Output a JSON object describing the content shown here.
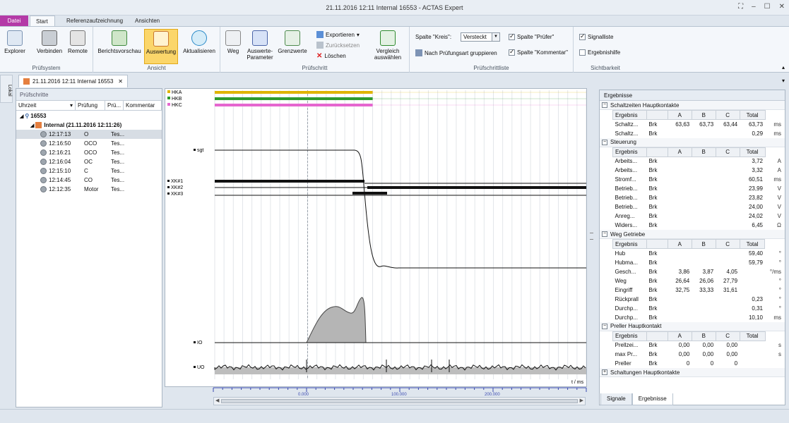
{
  "window": {
    "title": "21.11.2016 12:11 Internal 16553 - ACTAS Expert"
  },
  "ribbon_tabs": [
    "Datei",
    "Start",
    "Referenzaufzeichnung",
    "Ansichten"
  ],
  "ribbon": {
    "pruefsystem": {
      "label": "Prüfsystem",
      "explorer": "Explorer",
      "verbinden": "Verbinden",
      "remote": "Remote"
    },
    "ansicht": {
      "label": "Ansicht",
      "berichtsvorschau": "Berichtsvorschau",
      "auswertung": "Auswertung",
      "aktualisieren": "Aktualisieren"
    },
    "pruefschritt": {
      "label": "Prüfschritt",
      "weg": "Weg",
      "auswerteparameter_1": "Auswerte-",
      "auswerteparameter_2": "Parameter",
      "grenzwerte": "Grenzwerte",
      "exportieren": "Exportieren",
      "zuruecksetzen": "Zurücksetzen",
      "loeschen": "Löschen",
      "vergleich_1": "Vergleich",
      "vergleich_2": "auswählen"
    },
    "pruefschrittliste": {
      "label": "Prüfschrittliste",
      "spalte_kreis": "Spalte \"Kreis\":",
      "versteckt": "Versteckt",
      "nach_pruefungsart": "Nach Prüfungsart gruppieren",
      "spalte_pruefer": "Spalte \"Prüfer\"",
      "spalte_kommentar": "Spalte \"Kommentar\""
    },
    "sichtbarkeit": {
      "label": "Sichtbarkeit",
      "signalliste": "Signalliste",
      "ergebnishilfe": "Ergebnishilfe"
    }
  },
  "side_tab": "Lokal",
  "doc_tab": "21.11.2016 12:11 Internal 16553",
  "pruefschritte": {
    "header": "Prüfschritte",
    "columns": [
      "Uhrzeit",
      "Prüfung",
      "Prü...",
      "Kommentar"
    ],
    "root": "16553",
    "session": "Internal (21.11.2016 12:11:26)",
    "rows": [
      {
        "time": "12:17:13",
        "test": "O",
        "pruefer": "Tes...",
        "selected": true
      },
      {
        "time": "12:16:50",
        "test": "OCO",
        "pruefer": "Tes..."
      },
      {
        "time": "12:16:21",
        "test": "OCO",
        "pruefer": "Tes..."
      },
      {
        "time": "12:16:04",
        "test": "OC",
        "pruefer": "Tes..."
      },
      {
        "time": "12:15:10",
        "test": "C",
        "pruefer": "Tes..."
      },
      {
        "time": "12:14:45",
        "test": "CO",
        "pruefer": "Tes..."
      },
      {
        "time": "12:12:35",
        "test": "Motor",
        "pruefer": "Tes..."
      }
    ]
  },
  "chart_data": {
    "type": "line",
    "xlabel": "t / ms",
    "x_ticks": [
      "0.000",
      "100.000",
      "200.000"
    ],
    "xlim": [
      -100,
      300
    ],
    "signals": [
      {
        "name": "HKA",
        "color": "#e0b400"
      },
      {
        "name": "HKB",
        "color": "#2e9a2e"
      },
      {
        "name": "HKC",
        "color": "#e566cf"
      },
      {
        "name": "sgt"
      },
      {
        "name": "XK#1"
      },
      {
        "name": "XK#2"
      },
      {
        "name": "XK#3"
      },
      {
        "name": "IO"
      },
      {
        "name": "UO"
      }
    ],
    "bars": {
      "HKA_end_ms": 70,
      "HKB_end_ms": 70,
      "HKC_end_ms": 70
    }
  },
  "ergebnisse": {
    "header": "Ergebnisse",
    "cols": [
      "Ergebnis",
      "",
      "A",
      "B",
      "C",
      "Total"
    ],
    "sections": [
      {
        "title": "Schaltzeiten Hauptkontakte",
        "rows": [
          [
            "Schaltz...",
            "Brk",
            "63,63",
            "63,73",
            "63,44",
            "63,73",
            "ms"
          ],
          [
            "Schaltz...",
            "Brk",
            "",
            "",
            "",
            "0,29",
            "ms"
          ]
        ]
      },
      {
        "title": "Steuerung",
        "rows": [
          [
            "Arbeits...",
            "Brk",
            "",
            "",
            "",
            "3,72",
            "A"
          ],
          [
            "Arbeits...",
            "Brk",
            "",
            "",
            "",
            "3,32",
            "A"
          ],
          [
            "Stromf...",
            "Brk",
            "",
            "",
            "",
            "60,51",
            "ms"
          ],
          [
            "Betrieb...",
            "Brk",
            "",
            "",
            "",
            "23,99",
            "V"
          ],
          [
            "Betrieb...",
            "Brk",
            "",
            "",
            "",
            "23,82",
            "V"
          ],
          [
            "Betrieb...",
            "Brk",
            "",
            "",
            "",
            "24,00",
            "V"
          ],
          [
            "Anreg...",
            "Brk",
            "",
            "",
            "",
            "24,02",
            "V"
          ],
          [
            "Widers...",
            "Brk",
            "",
            "",
            "",
            "6,45",
            "Ω"
          ]
        ]
      },
      {
        "title": "Weg Getriebe",
        "rows": [
          [
            "Hub",
            "Brk",
            "",
            "",
            "",
            "59,40",
            "°"
          ],
          [
            "Hubma...",
            "Brk",
            "",
            "",
            "",
            "59,79",
            "°"
          ],
          [
            "Gesch...",
            "Brk",
            "3,86",
            "3,87",
            "4,05",
            "",
            "°/ms"
          ],
          [
            "Weg",
            "Brk",
            "26,64",
            "26,06",
            "27,79",
            "",
            "°"
          ],
          [
            "Eingriff",
            "Brk",
            "32,75",
            "33,33",
            "31,61",
            "",
            "°"
          ],
          [
            "Rückprall",
            "Brk",
            "",
            "",
            "",
            "0,23",
            "°"
          ],
          [
            "Durchp...",
            "Brk",
            "",
            "",
            "",
            "0,31",
            "°"
          ],
          [
            "Durchp...",
            "Brk",
            "",
            "",
            "",
            "10,10",
            "ms"
          ]
        ]
      },
      {
        "title": "Preller Hauptkontakt",
        "rows": [
          [
            "Prellzei...",
            "Brk",
            "0,00",
            "0,00",
            "0,00",
            "",
            "s"
          ],
          [
            "max Pr...",
            "Brk",
            "0,00",
            "0,00",
            "0,00",
            "",
            "s"
          ],
          [
            "Preller",
            "Brk",
            "0",
            "0",
            "0",
            "",
            ""
          ]
        ]
      },
      {
        "title": "Schaltungen Hauptkontakte",
        "collapsed": true,
        "rows": []
      }
    ],
    "tabs": [
      "Signale",
      "Ergebnisse"
    ]
  },
  "colors": {
    "accent_file": "#b43aa7",
    "selected_button": "#fbd66a"
  }
}
